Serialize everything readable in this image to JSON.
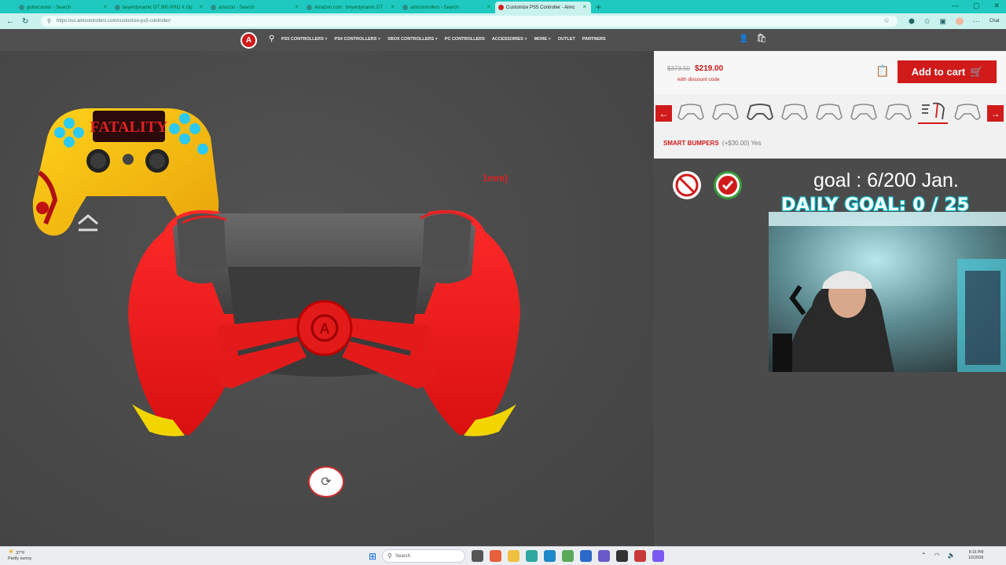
{
  "browser": {
    "tabs": [
      {
        "label": "guitarcenter - Search",
        "active": false
      },
      {
        "label": "beyerdynamic DT 990 PRO X Op",
        "active": false
      },
      {
        "label": "amazon - Search",
        "active": false
      },
      {
        "label": "Amazon.com : beyerdynamic DT",
        "active": false
      },
      {
        "label": "aimcontrollers - Search",
        "active": false
      },
      {
        "label": "Customize PS5 Controller - Aimc",
        "active": true
      }
    ],
    "url": "https://us.aimcontrollers.com/customize-ps5-controller/",
    "chat_label": "Chat"
  },
  "site": {
    "logo_letter": "A",
    "nav": [
      "PS5 CONTROLLERS ˅",
      "PS4 CONTROLLERS ˅",
      "XBOX CONTROLLERS ˅",
      "PC CONTROLLERS",
      "ACCESSORIES ˅",
      "MORE ˅",
      "OUTLET",
      "PARTNERS"
    ]
  },
  "viewer": {
    "thumb_text": "FATALITY",
    "mm_label": "1mm)"
  },
  "product": {
    "old_price": "$373.50",
    "price": "$219.00",
    "discount_note": "with discount code",
    "add_to_cart": "Add to cart",
    "option_name": "SMART BUMPERS",
    "option_value": "(+$30.00) Yes",
    "option_icons": [
      "controller-1",
      "controller-2",
      "controller-3",
      "controller-4",
      "controller-5",
      "controller-6",
      "controller-7",
      "controller-8-selected",
      "controller-9"
    ]
  },
  "overlay": {
    "goal_text": "goal : 6/200 Jan.",
    "daily_goal": "DAILY GOAL: 0 / 25"
  },
  "taskbar": {
    "temp": "37°F",
    "weather": "Partly sunny",
    "search_placeholder": "Search",
    "time": "8:16 PM",
    "date": "1/2/2026"
  },
  "colors": {
    "brand_red": "#d11a1a",
    "tab_teal": "#1fc9c0",
    "overlay_cyan": "#19d4e6"
  }
}
